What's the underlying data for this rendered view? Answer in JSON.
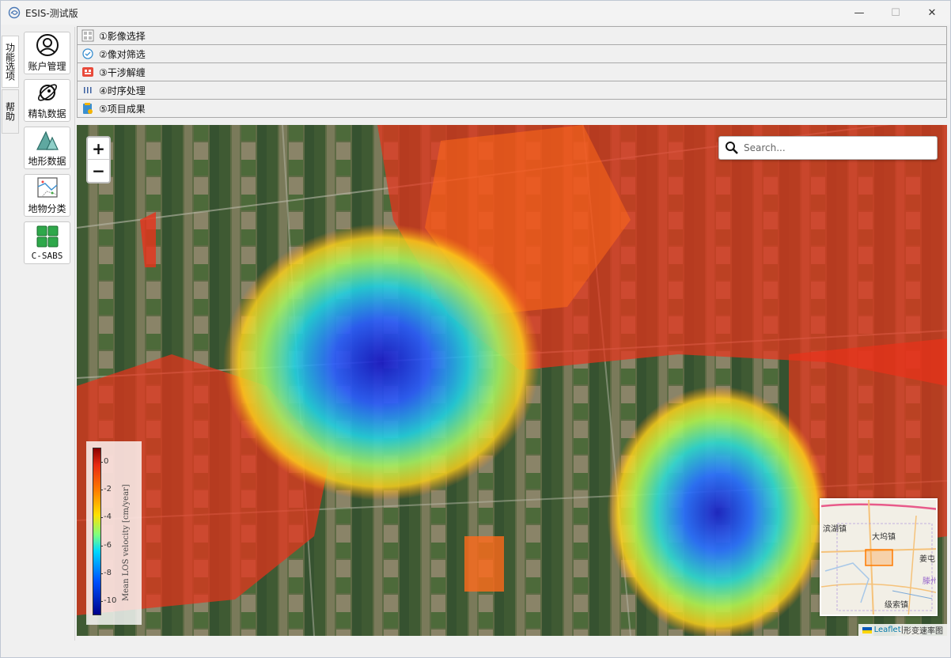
{
  "window": {
    "title": "ESIS-测试版",
    "controls": {
      "minimize": "—",
      "maximize": "☐",
      "close": "✕"
    }
  },
  "side_tabs": [
    {
      "label": "功能选项",
      "active": true
    },
    {
      "label": "帮助",
      "active": false
    }
  ],
  "tools": [
    {
      "label": "账户管理",
      "icon": "user-icon"
    },
    {
      "label": "精轨数据",
      "icon": "satellite-icon"
    },
    {
      "label": "地形数据",
      "icon": "terrain-icon"
    },
    {
      "label": "地物分类",
      "icon": "classification-icon"
    },
    {
      "label": "C-SABS",
      "icon": "grid-icon"
    }
  ],
  "workflow": [
    {
      "label": "①影像选择",
      "icon": "image-select-icon"
    },
    {
      "label": "②像对筛选",
      "icon": "pair-filter-icon"
    },
    {
      "label": "③干涉解缠",
      "icon": "interferogram-icon"
    },
    {
      "label": "④时序处理",
      "icon": "timeseries-icon"
    },
    {
      "label": "⑤项目成果",
      "icon": "results-icon"
    }
  ],
  "map": {
    "zoom_in": "+",
    "zoom_out": "−",
    "search_placeholder": "Search...",
    "colorbar": {
      "label": "Mean LOS velocity [cm/year]",
      "ticks": [
        "0",
        "-2",
        "-4",
        "-6",
        "-8",
        "-10"
      ],
      "range": [
        -11,
        1
      ]
    },
    "minimap": {
      "labels": [
        "滨湖镇",
        "大坞镇",
        "姜屯",
        "滕州",
        "级索镇"
      ]
    },
    "attribution": {
      "leaflet": "Leaflet",
      "separator": " | ",
      "source": "形变速率图"
    }
  },
  "colors": {
    "accent_blue": "#2f6fbf",
    "deformation_high": "#e8321a",
    "deformation_low": "#1a1fd6"
  }
}
